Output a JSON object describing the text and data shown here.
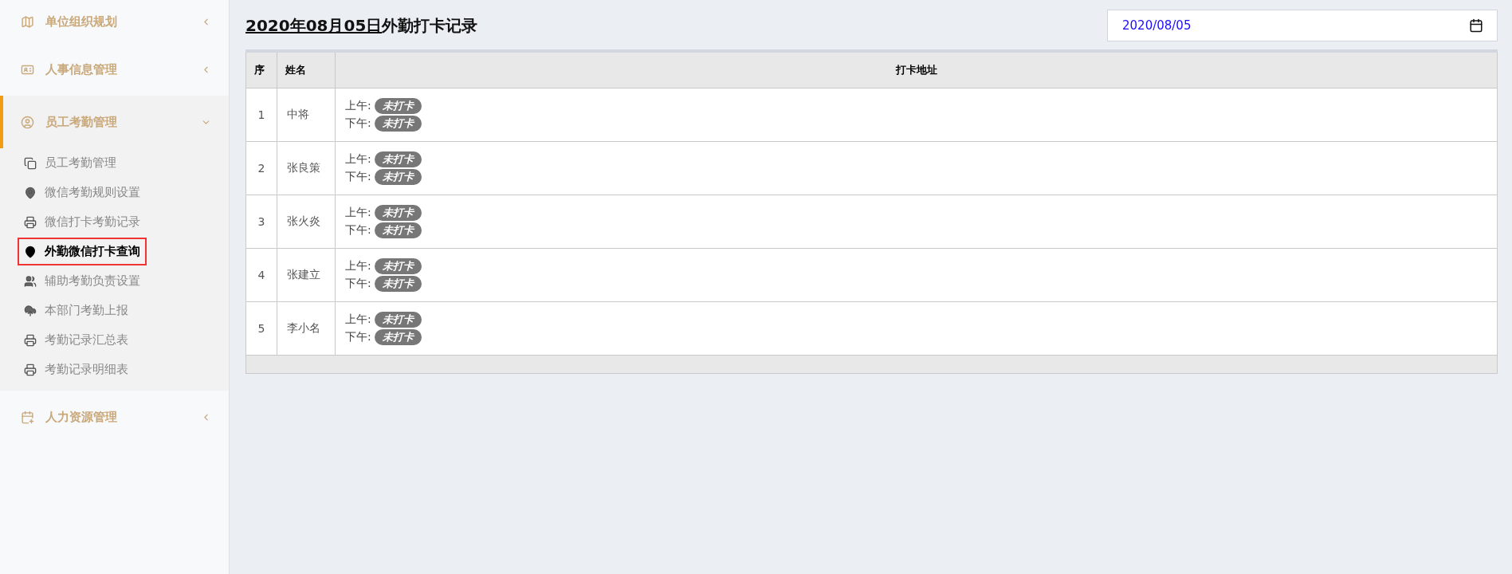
{
  "sidebar": {
    "groups": [
      {
        "label": "单位组织规划",
        "expanded": false
      },
      {
        "label": "人事信息管理",
        "expanded": false
      },
      {
        "label": "员工考勤管理",
        "expanded": true,
        "items": [
          {
            "label": "员工考勤管理",
            "selected": false
          },
          {
            "label": "微信考勤规则设置",
            "selected": false
          },
          {
            "label": "微信打卡考勤记录",
            "selected": false
          },
          {
            "label": "外勤微信打卡查询",
            "selected": true
          },
          {
            "label": "辅助考勤负责设置",
            "selected": false
          },
          {
            "label": "本部门考勤上报",
            "selected": false
          },
          {
            "label": "考勤记录汇总表",
            "selected": false
          },
          {
            "label": "考勤记录明细表",
            "selected": false
          }
        ]
      },
      {
        "label": "人力资源管理",
        "expanded": false
      }
    ]
  },
  "title": {
    "date": "2020年08月05日",
    "text": "外勤打卡记录"
  },
  "date_field": {
    "value": "2020/08/05"
  },
  "table": {
    "columns": [
      "序",
      "姓名",
      "打卡地址"
    ],
    "rows": [
      {
        "index": "1",
        "name": "中将",
        "am_label": "上午:",
        "am": "未打卡",
        "pm_label": "下午:",
        "pm": "未打卡"
      },
      {
        "index": "2",
        "name": "张良策",
        "am_label": "上午:",
        "am": "未打卡",
        "pm_label": "下午:",
        "pm": "未打卡"
      },
      {
        "index": "3",
        "name": "张火炎",
        "am_label": "上午:",
        "am": "未打卡",
        "pm_label": "下午:",
        "pm": "未打卡"
      },
      {
        "index": "4",
        "name": "张建立",
        "am_label": "上午:",
        "am": "未打卡",
        "pm_label": "下午:",
        "pm": "未打卡"
      },
      {
        "index": "5",
        "name": "李小名",
        "am_label": "上午:",
        "am": "未打卡",
        "pm_label": "下午:",
        "pm": "未打卡"
      }
    ]
  }
}
